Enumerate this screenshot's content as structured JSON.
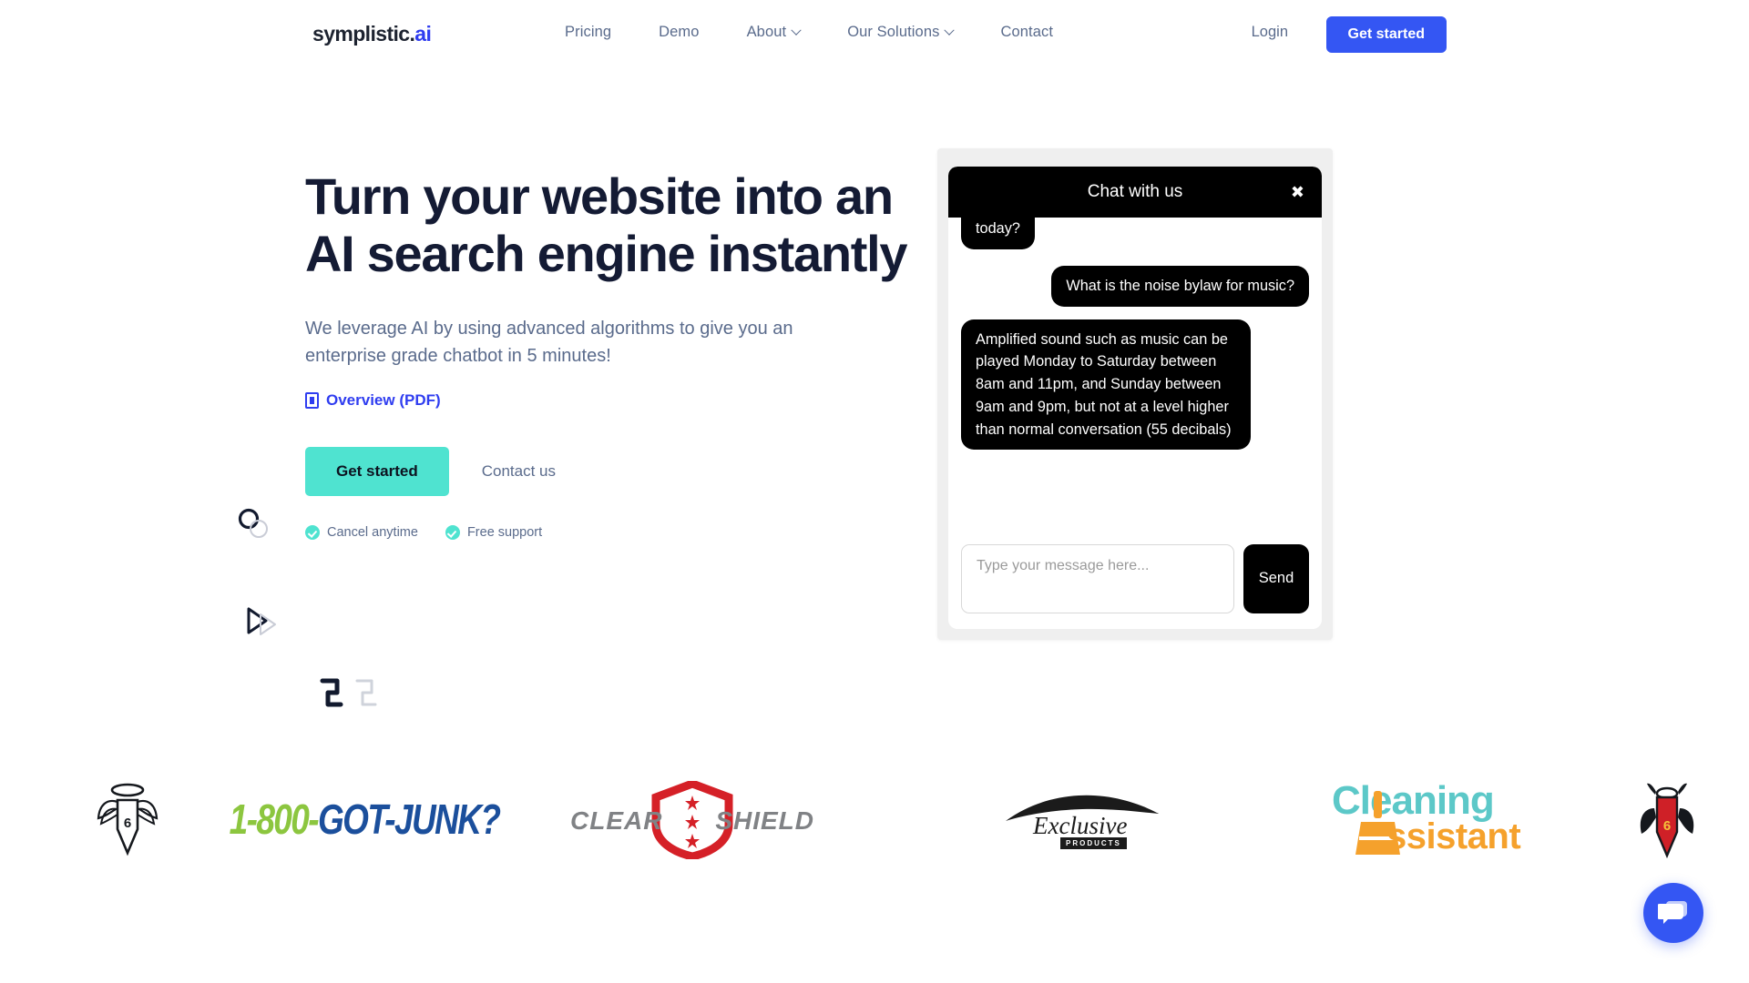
{
  "header": {
    "logo": {
      "name": "symplistic",
      "dot": ".",
      "accent": "ai"
    },
    "nav": [
      {
        "label": "Pricing",
        "has_dropdown": false
      },
      {
        "label": "Demo",
        "has_dropdown": false
      },
      {
        "label": "About",
        "has_dropdown": true
      },
      {
        "label": "Our Solutions",
        "has_dropdown": true
      },
      {
        "label": "Contact",
        "has_dropdown": false
      }
    ],
    "login_label": "Login",
    "cta_label": "Get started",
    "cta_color": "#3456f3"
  },
  "hero": {
    "headline": "Turn your website into an AI search engine instantly",
    "subhead": "We leverage AI by using advanced algorithms to give you an enterprise grade chatbot in 5 minutes!",
    "pdf_link": "Overview (PDF)",
    "pdf_link_color": "#2f3df0",
    "primary_cta": "Get started",
    "primary_cta_color": "#4fe3d0",
    "secondary_cta": "Contact us",
    "ticks": [
      {
        "label": "Cancel anytime"
      },
      {
        "label": "Free support"
      }
    ]
  },
  "chat": {
    "title": "Chat with us",
    "close_glyph": "✖",
    "messages": [
      {
        "from": "bot",
        "text": "today?"
      },
      {
        "from": "user",
        "text": "What is the noise bylaw for music?"
      },
      {
        "from": "bot",
        "text": "Amplified sound such as music can be played Monday to Saturday between 8am and 11pm, and Sunday between 9am and 9pm, but not at a level higher than normal conversation (55 decibals)"
      }
    ],
    "input_placeholder": "Type your message here...",
    "input_value": "",
    "send_label": "Send"
  },
  "logos": [
    {
      "name": "angel-pencil",
      "text": "6"
    },
    {
      "name": "1-800-got-junk",
      "text_green": "1-800-",
      "text_blue": "GOT-JUNK?"
    },
    {
      "name": "clear-shield",
      "text_left": "CLEAR",
      "text_right": "SHIELD"
    },
    {
      "name": "exclusive-products",
      "text": "Exclusive",
      "sub": "PRODUCTS"
    },
    {
      "name": "cleaning-assistant",
      "text_top": "leaning",
      "text_top_first": "C",
      "text_bottom": "ssistant"
    },
    {
      "name": "devil-pencil",
      "text": "6"
    }
  ],
  "fab": {
    "icon": "chat-bubbles-icon",
    "color": "#3456f3"
  }
}
